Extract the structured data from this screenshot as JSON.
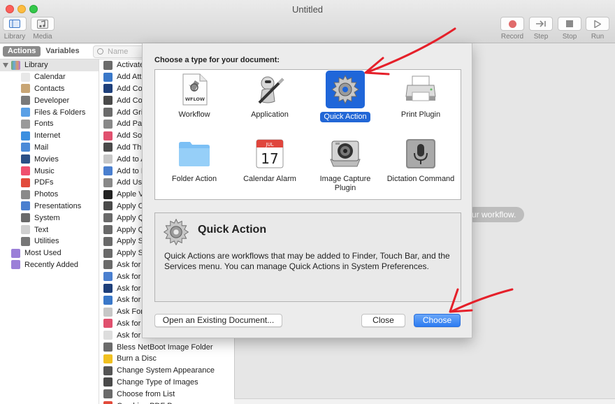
{
  "window": {
    "title": "Untitled"
  },
  "toolbar": {
    "library_label": "Library",
    "media_label": "Media",
    "record_label": "Record",
    "step_label": "Step",
    "stop_label": "Stop",
    "run_label": "Run"
  },
  "sidebar": {
    "tab_actions": "Actions",
    "tab_variables": "Variables",
    "search_placeholder": "Name",
    "library_label": "Library",
    "library_items": [
      {
        "label": "Calendar",
        "color": "#e8e8e8"
      },
      {
        "label": "Contacts",
        "color": "#c8a574"
      },
      {
        "label": "Developer",
        "color": "#7a7a7a"
      },
      {
        "label": "Files & Folders",
        "color": "#5aa0e6"
      },
      {
        "label": "Fonts",
        "color": "#9a9a9a"
      },
      {
        "label": "Internet",
        "color": "#3b8fe0"
      },
      {
        "label": "Mail",
        "color": "#4a8ad8"
      },
      {
        "label": "Movies",
        "color": "#2a4f86"
      },
      {
        "label": "Music",
        "color": "#f0506e"
      },
      {
        "label": "PDFs",
        "color": "#e24b3b"
      },
      {
        "label": "Photos",
        "color": "#8a8a8a"
      },
      {
        "label": "Presentations",
        "color": "#4a7fcf"
      },
      {
        "label": "System",
        "color": "#6a6a6a"
      },
      {
        "label": "Text",
        "color": "#cfcfcf"
      },
      {
        "label": "Utilities",
        "color": "#777777"
      }
    ],
    "top_items": [
      {
        "label": "Most Used",
        "color": "#9b7fd8"
      },
      {
        "label": "Recently Added",
        "color": "#9b7fd8"
      }
    ],
    "actions": [
      "Activate",
      "Add Atta",
      "Add Col",
      "Add Con",
      "Add Grid",
      "Add Pac",
      "Add Son",
      "Add Thu",
      "Add to A",
      "Add to F",
      "Add Use",
      "Apple Ve",
      "Apply Co",
      "Apply Qu",
      "Apply Qu",
      "Apply SQ",
      "Apply Sy",
      "Ask for C",
      "Ask for F",
      "Ask for M",
      "Ask for P",
      "Ask For",
      "Ask for S",
      "Ask for T",
      "Bless NetBoot Image Folder",
      "Burn a Disc",
      "Change System Appearance",
      "Change Type of Images",
      "Choose from List",
      "Combine PDF Pages"
    ],
    "action_colors": [
      "#6b6b6b",
      "#3a78c9",
      "#1e3f7a",
      "#4a4a4a",
      "#6b6b6b",
      "#888888",
      "#e0506e",
      "#4a4a4a",
      "#c7c7c7",
      "#4a7fcf",
      "#888888",
      "#222222",
      "#4a4a4a",
      "#6a6a6a",
      "#6a6a6a",
      "#6a6a6a",
      "#6a6a6a",
      "#6a6a6a",
      "#4a7fcf",
      "#1e3f7a",
      "#3a78c9",
      "#c7c7c7",
      "#e0506e",
      "#dddddd",
      "#6b6b6b",
      "#f0c020",
      "#555555",
      "#4a4a4a",
      "#6a6a6a",
      "#e24b3b"
    ]
  },
  "main": {
    "hint": "ur workflow."
  },
  "dialog": {
    "prompt": "Choose a type for your document:",
    "types": [
      {
        "label": "Workflow"
      },
      {
        "label": "Application"
      },
      {
        "label": "Quick Action"
      },
      {
        "label": "Print Plugin"
      },
      {
        "label": "Folder Action"
      },
      {
        "label": "Calendar Alarm"
      },
      {
        "label": "Image Capture Plugin"
      },
      {
        "label": "Dictation Command"
      }
    ],
    "selected_type": "Quick Action",
    "workflow_badge": "WFLOW",
    "calendar_month": "JUL",
    "calendar_day": "17",
    "description_title": "Quick Action",
    "description_text": "Quick Actions are workflows that may be added to Finder, Touch Bar, and the Services menu. You can manage Quick Actions in System Preferences.",
    "open_existing_label": "Open an Existing Document...",
    "close_label": "Close",
    "choose_label": "Choose"
  },
  "colors": {
    "accent": "#2267d6",
    "annotation": "#e5202a"
  }
}
